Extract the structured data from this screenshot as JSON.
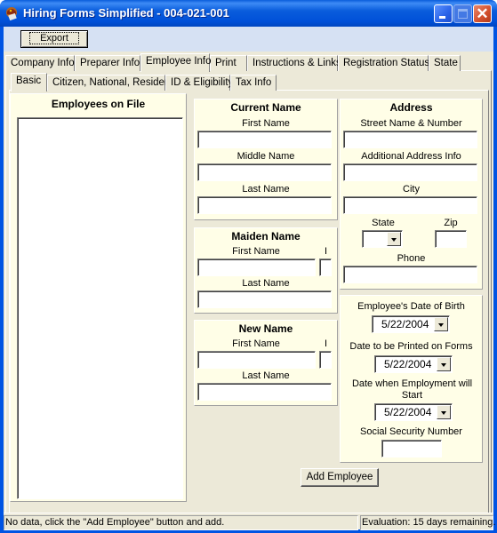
{
  "window": {
    "title": "Hiring Forms Simplified - 004-021-001",
    "icon": "app-helmet-icon",
    "controls": {
      "minimize": "minimize-icon",
      "maximize": "maximize-icon",
      "close": "close-icon"
    }
  },
  "toolbar": {
    "export_label": "Export"
  },
  "main_tabs": [
    {
      "label": "Company Info",
      "active": false
    },
    {
      "label": "Preparer Info",
      "active": false
    },
    {
      "label": "Employee Info",
      "active": true
    },
    {
      "label": "Print",
      "active": false
    },
    {
      "label": "Instructions & Links",
      "active": false
    },
    {
      "label": "Registration Status",
      "active": false
    },
    {
      "label": "State",
      "active": false
    }
  ],
  "sub_tabs": [
    {
      "label": "Basic",
      "active": true
    },
    {
      "label": "Citizen, National, Resident",
      "active": false
    },
    {
      "label": "ID & Eligibility",
      "active": false
    },
    {
      "label": "Tax Info",
      "active": false
    }
  ],
  "employees_panel": {
    "title": "Employees on File",
    "items": []
  },
  "current_name": {
    "title": "Current Name",
    "first_label": "First Name",
    "first_value": "",
    "middle_label": "Middle Name",
    "middle_value": "",
    "last_label": "Last Name",
    "last_value": ""
  },
  "maiden_name": {
    "title": "Maiden Name",
    "first_label": "First Name",
    "first_value": "",
    "initial_label": "I",
    "initial_value": "",
    "last_label": "Last Name",
    "last_value": ""
  },
  "new_name": {
    "title": "New Name",
    "first_label": "First Name",
    "first_value": "",
    "initial_label": "I",
    "initial_value": "",
    "last_label": "Last Name",
    "last_value": ""
  },
  "address": {
    "title": "Address",
    "street_label": "Street Name & Number",
    "street_value": "",
    "additional_label": "Additional Address Info",
    "additional_value": "",
    "city_label": "City",
    "city_value": "",
    "state_label": "State",
    "state_value": "",
    "zip_label": "Zip",
    "zip_value": "",
    "phone_label": "Phone",
    "phone_value": ""
  },
  "dates": {
    "dob_label": "Employee's Date of Birth",
    "dob_value": "5/22/2004",
    "print_label": "Date to be Printed on Forms",
    "print_value": "5/22/2004",
    "start_label": "Date when Employment will Start",
    "start_value": "5/22/2004",
    "ssn_label": "Social Security Number",
    "ssn_value": ""
  },
  "add_employee_label": "Add Employee",
  "status": {
    "left": "No data, click the \"Add Employee\" button and add.",
    "right": "Evaluation: 15 days remaining."
  }
}
